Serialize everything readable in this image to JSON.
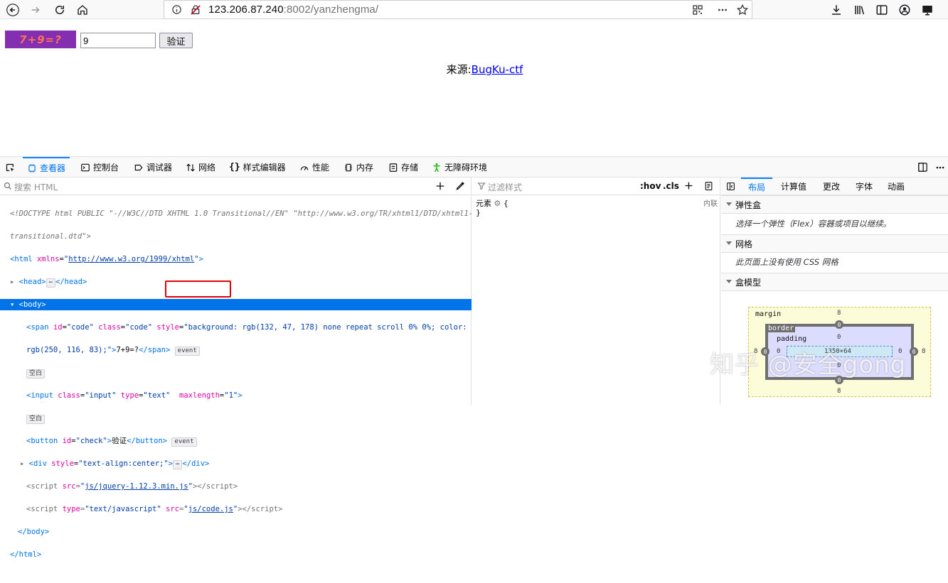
{
  "browser": {
    "url_host": "123.206.87.240",
    "url_rest": ":8002/yanzhengma/"
  },
  "page": {
    "captcha_text": "7+9=?",
    "captcha_colors": {
      "background": "#842fb2",
      "text": "#fa7453"
    },
    "input_value": "9",
    "button_label": "验证",
    "source_prefix": "来源:",
    "source_link": "BugKu-ctf"
  },
  "devtools": {
    "tabs": [
      "查看器",
      "控制台",
      "调试器",
      "网络",
      "样式编辑器",
      "性能",
      "内存",
      "存储",
      "无障碍环境"
    ],
    "search_placeholder": "搜索 HTML",
    "filter_placeholder": "过滤样式",
    "hov_label": ":hov",
    "cls_label": ".cls",
    "element_rule": "元素",
    "rule_open": "{",
    "rule_close": "}",
    "inline_label": "内联",
    "markup": {
      "doctype_1": "<!DOCTYPE html PUBLIC \"-//W3C//DTD XHTML 1.0 Transitional//EN\" \"http://www.w3.org/TR/xhtml1/DTD/xhtml1-",
      "doctype_2": "transitional.dtd\">",
      "html_xmlns": "http://www.w3.org/1999/xhtml",
      "span_style_1": "background: rgb(132, 47, 178) none repeat scroll 0% 0%; color:",
      "span_style_2": "rgb(250, 116, 83);",
      "span_text": "7+9=?",
      "event_badge": "event",
      "whitespace_badge": "空白",
      "button_text": "验证",
      "div_style": "text-align:center;",
      "script1_src": "js/jquery-1.12.3.min.js",
      "script2_src": "js/code.js",
      "maxlength_value": "1"
    },
    "right_tabs": [
      "布局",
      "计算值",
      "更改",
      "字体",
      "动画"
    ],
    "flexbox": {
      "title": "弹性盒",
      "text": "选择一个弹性（Flex）容器或项目以继续。"
    },
    "grid": {
      "title": "网格",
      "text": "此页面上没有使用 CSS 网格"
    },
    "box_model": {
      "title": "盒模型",
      "margin_label": "margin",
      "border_label": "border",
      "padding_label": "padding",
      "margin": "8",
      "border": "0",
      "padding": "0",
      "content": "1350×64"
    },
    "watermark": "知乎 @安全gong"
  }
}
